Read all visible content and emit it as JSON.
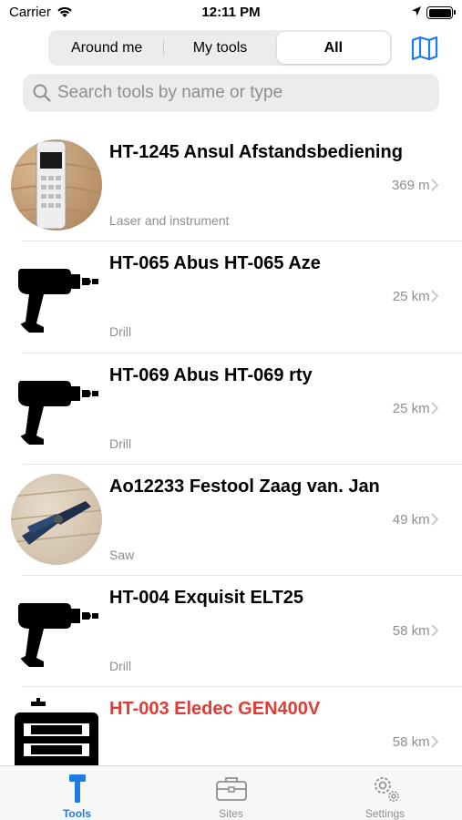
{
  "status_bar": {
    "carrier": "Carrier",
    "time": "12:11 PM"
  },
  "segments": [
    {
      "label": "Around me",
      "selected": false
    },
    {
      "label": "My tools",
      "selected": false
    },
    {
      "label": "All",
      "selected": true
    }
  ],
  "map_button": {
    "icon": "map-icon"
  },
  "search": {
    "placeholder": "Search tools by name or type",
    "value": ""
  },
  "tools": [
    {
      "name": "HT-1245 Ansul Afstandsbediening",
      "distance": "369 m",
      "category": "Laser and instrument",
      "image": "remote-control-photo",
      "alert": false
    },
    {
      "name": "HT-065 Abus HT-065 Aze",
      "distance": "25 km",
      "category": "Drill",
      "image": "drill-icon",
      "alert": false
    },
    {
      "name": "HT-069 Abus HT-069 rty",
      "distance": "25 km",
      "category": "Drill",
      "image": "drill-icon",
      "alert": false
    },
    {
      "name": "Ao12233 Festool Zaag  van. Jan",
      "distance": "49 km",
      "category": "Saw",
      "image": "pliers-photo",
      "alert": false
    },
    {
      "name": "HT-004 Exquisit ELT25",
      "distance": "58 km",
      "category": "Drill",
      "image": "drill-icon",
      "alert": false
    },
    {
      "name": "HT-003 Eledec GEN400V",
      "distance": "58 km",
      "category": "",
      "image": "generator-icon",
      "alert": true
    }
  ],
  "tabbar": [
    {
      "label": "Tools",
      "icon": "hammer-icon",
      "active": true
    },
    {
      "label": "Sites",
      "icon": "toolbox-icon",
      "active": false
    },
    {
      "label": "Settings",
      "icon": "gears-icon",
      "active": false
    }
  ],
  "colors": {
    "accent": "#1c7ce5",
    "alert": "#e03b35",
    "secondary_text": "#8e8e93"
  }
}
